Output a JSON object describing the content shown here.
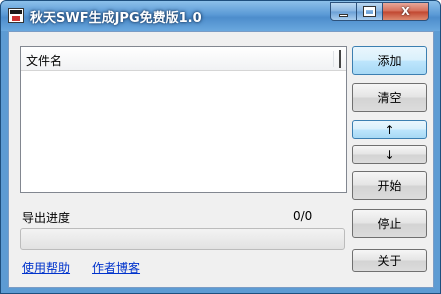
{
  "window": {
    "title": "秋天SWF生成JPG免费版1.0",
    "controls": {
      "close_glyph": "X"
    }
  },
  "list": {
    "columns": [
      "文件名"
    ],
    "rows": []
  },
  "buttons": {
    "add": "添加",
    "clear": "清空",
    "up": "↑",
    "down": "↓",
    "start": "开始",
    "stop": "停止",
    "about": "关于"
  },
  "progress": {
    "label": "导出进度",
    "count": "0/0",
    "value": 0
  },
  "links": {
    "help": "使用帮助",
    "blog": "作者博客"
  },
  "colors": {
    "titlebar": "#5b9ad6",
    "link": "#0033cc",
    "progress_fill": "#06b025"
  }
}
